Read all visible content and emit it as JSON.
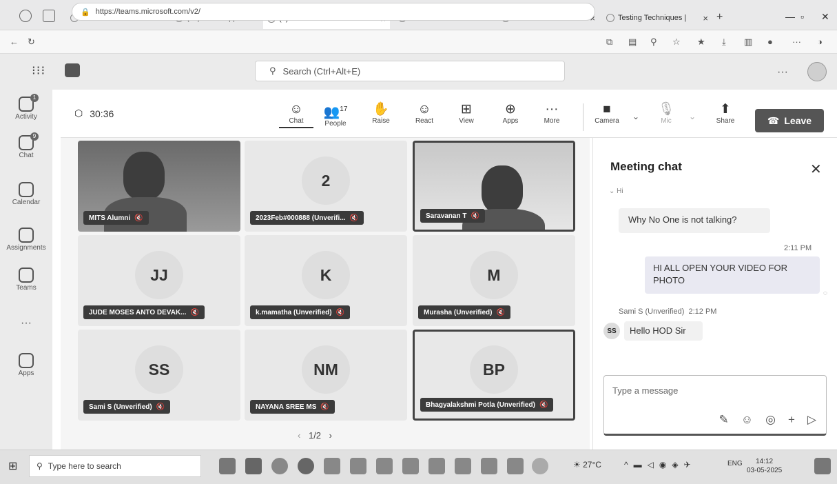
{
  "browser": {
    "tabs": [
      {
        "label": "Mail - MITS Alumni -",
        "active": false
      },
      {
        "label": "(51) WhatsApp",
        "active": false
      },
      {
        "label": "(2) Alumni Meet",
        "active": true
      },
      {
        "label": "ChatGPT",
        "active": false
      },
      {
        "label": "Firewall Authenticati",
        "active": false
      },
      {
        "label": "Testing Techniques |",
        "active": false
      }
    ],
    "url": "https://teams.microsoft.com/v2/"
  },
  "teams": {
    "search_placeholder": "Search (Ctrl+Alt+E)",
    "more": "···"
  },
  "rail": [
    {
      "label": "Activity",
      "badge": "1",
      "icon": "bell-icon"
    },
    {
      "label": "Chat",
      "badge": "9",
      "icon": "chat-icon"
    },
    {
      "label": "Calendar",
      "badge": "",
      "icon": "calendar-icon"
    },
    {
      "label": "Assignments",
      "badge": "",
      "icon": "assignments-icon"
    },
    {
      "label": "Teams",
      "badge": "",
      "icon": "teams-icon"
    },
    {
      "label": "···",
      "badge": "",
      "icon": "more-icon"
    },
    {
      "label": "Apps",
      "badge": "",
      "icon": "apps-icon"
    }
  ],
  "meeting": {
    "timer": "30:36",
    "people_count": "17",
    "controls": {
      "chat": "Chat",
      "people": "People",
      "raise": "Raise",
      "react": "React",
      "view": "View",
      "apps": "Apps",
      "more": "More",
      "camera": "Camera",
      "mic": "Mic",
      "share": "Share",
      "leave": "Leave"
    }
  },
  "tiles": [
    {
      "name": "MITS Alumni",
      "initials": "",
      "video": true,
      "highlight": false
    },
    {
      "name": "2023Feb#000888 (Unverifi...",
      "initials": "2",
      "video": false,
      "highlight": false
    },
    {
      "name": "Saravanan T",
      "initials": "",
      "video": true,
      "highlight": true
    },
    {
      "name": "JUDE MOSES ANTO DEVAK...",
      "initials": "JJ",
      "video": false,
      "highlight": false
    },
    {
      "name": "k.mamatha (Unverified)",
      "initials": "K",
      "video": false,
      "highlight": false
    },
    {
      "name": "Murasha (Unverified)",
      "initials": "M",
      "video": false,
      "highlight": false
    },
    {
      "name": "Sami S (Unverified)",
      "initials": "SS",
      "video": false,
      "highlight": false
    },
    {
      "name": "NAYANA SREE MS",
      "initials": "NM",
      "video": false,
      "highlight": false
    },
    {
      "name": "Bhagyalakshmi Potla (Unverified)",
      "initials": "BP",
      "video": false,
      "highlight": true
    }
  ],
  "pager": {
    "text": "1/2"
  },
  "chat": {
    "title": "Meeting chat",
    "partial_sender": "Hi",
    "messages": [
      {
        "text": "Why No One is not talking?"
      },
      {
        "time": "2:11 PM",
        "text": "HI ALL OPEN YOUR VIDEO FOR PHOTO"
      },
      {
        "sender": "Sami S (Unverified)",
        "time": "2:12 PM",
        "avatar": "SS",
        "text": "Hello HOD Sir"
      }
    ],
    "compose_placeholder": "Type a message"
  },
  "taskbar": {
    "search_placeholder": "Type here to search",
    "weather": "27°C",
    "lang": "ENG",
    "time": "14:12",
    "date": "03-05-2025"
  }
}
